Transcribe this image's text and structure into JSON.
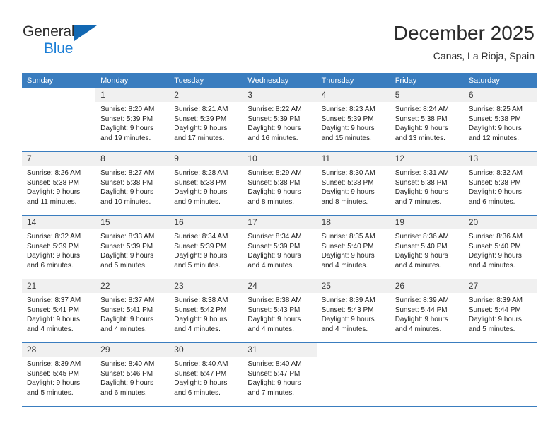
{
  "brand": {
    "name_primary": "General",
    "name_secondary": "Blue",
    "logo_icon": "triangle-logo-icon"
  },
  "header": {
    "month_title": "December 2025",
    "location": "Canas, La Rioja, Spain"
  },
  "calendar": {
    "accent_color": "#3a7dbf",
    "weekday_headers": [
      "Sunday",
      "Monday",
      "Tuesday",
      "Wednesday",
      "Thursday",
      "Friday",
      "Saturday"
    ],
    "weeks": [
      [
        {
          "day": "",
          "lines": []
        },
        {
          "day": "1",
          "lines": [
            "Sunrise: 8:20 AM",
            "Sunset: 5:39 PM",
            "Daylight: 9 hours",
            "and 19 minutes."
          ]
        },
        {
          "day": "2",
          "lines": [
            "Sunrise: 8:21 AM",
            "Sunset: 5:39 PM",
            "Daylight: 9 hours",
            "and 17 minutes."
          ]
        },
        {
          "day": "3",
          "lines": [
            "Sunrise: 8:22 AM",
            "Sunset: 5:39 PM",
            "Daylight: 9 hours",
            "and 16 minutes."
          ]
        },
        {
          "day": "4",
          "lines": [
            "Sunrise: 8:23 AM",
            "Sunset: 5:39 PM",
            "Daylight: 9 hours",
            "and 15 minutes."
          ]
        },
        {
          "day": "5",
          "lines": [
            "Sunrise: 8:24 AM",
            "Sunset: 5:38 PM",
            "Daylight: 9 hours",
            "and 13 minutes."
          ]
        },
        {
          "day": "6",
          "lines": [
            "Sunrise: 8:25 AM",
            "Sunset: 5:38 PM",
            "Daylight: 9 hours",
            "and 12 minutes."
          ]
        }
      ],
      [
        {
          "day": "7",
          "lines": [
            "Sunrise: 8:26 AM",
            "Sunset: 5:38 PM",
            "Daylight: 9 hours",
            "and 11 minutes."
          ]
        },
        {
          "day": "8",
          "lines": [
            "Sunrise: 8:27 AM",
            "Sunset: 5:38 PM",
            "Daylight: 9 hours",
            "and 10 minutes."
          ]
        },
        {
          "day": "9",
          "lines": [
            "Sunrise: 8:28 AM",
            "Sunset: 5:38 PM",
            "Daylight: 9 hours",
            "and 9 minutes."
          ]
        },
        {
          "day": "10",
          "lines": [
            "Sunrise: 8:29 AM",
            "Sunset: 5:38 PM",
            "Daylight: 9 hours",
            "and 8 minutes."
          ]
        },
        {
          "day": "11",
          "lines": [
            "Sunrise: 8:30 AM",
            "Sunset: 5:38 PM",
            "Daylight: 9 hours",
            "and 8 minutes."
          ]
        },
        {
          "day": "12",
          "lines": [
            "Sunrise: 8:31 AM",
            "Sunset: 5:38 PM",
            "Daylight: 9 hours",
            "and 7 minutes."
          ]
        },
        {
          "day": "13",
          "lines": [
            "Sunrise: 8:32 AM",
            "Sunset: 5:38 PM",
            "Daylight: 9 hours",
            "and 6 minutes."
          ]
        }
      ],
      [
        {
          "day": "14",
          "lines": [
            "Sunrise: 8:32 AM",
            "Sunset: 5:39 PM",
            "Daylight: 9 hours",
            "and 6 minutes."
          ]
        },
        {
          "day": "15",
          "lines": [
            "Sunrise: 8:33 AM",
            "Sunset: 5:39 PM",
            "Daylight: 9 hours",
            "and 5 minutes."
          ]
        },
        {
          "day": "16",
          "lines": [
            "Sunrise: 8:34 AM",
            "Sunset: 5:39 PM",
            "Daylight: 9 hours",
            "and 5 minutes."
          ]
        },
        {
          "day": "17",
          "lines": [
            "Sunrise: 8:34 AM",
            "Sunset: 5:39 PM",
            "Daylight: 9 hours",
            "and 4 minutes."
          ]
        },
        {
          "day": "18",
          "lines": [
            "Sunrise: 8:35 AM",
            "Sunset: 5:40 PM",
            "Daylight: 9 hours",
            "and 4 minutes."
          ]
        },
        {
          "day": "19",
          "lines": [
            "Sunrise: 8:36 AM",
            "Sunset: 5:40 PM",
            "Daylight: 9 hours",
            "and 4 minutes."
          ]
        },
        {
          "day": "20",
          "lines": [
            "Sunrise: 8:36 AM",
            "Sunset: 5:40 PM",
            "Daylight: 9 hours",
            "and 4 minutes."
          ]
        }
      ],
      [
        {
          "day": "21",
          "lines": [
            "Sunrise: 8:37 AM",
            "Sunset: 5:41 PM",
            "Daylight: 9 hours",
            "and 4 minutes."
          ]
        },
        {
          "day": "22",
          "lines": [
            "Sunrise: 8:37 AM",
            "Sunset: 5:41 PM",
            "Daylight: 9 hours",
            "and 4 minutes."
          ]
        },
        {
          "day": "23",
          "lines": [
            "Sunrise: 8:38 AM",
            "Sunset: 5:42 PM",
            "Daylight: 9 hours",
            "and 4 minutes."
          ]
        },
        {
          "day": "24",
          "lines": [
            "Sunrise: 8:38 AM",
            "Sunset: 5:43 PM",
            "Daylight: 9 hours",
            "and 4 minutes."
          ]
        },
        {
          "day": "25",
          "lines": [
            "Sunrise: 8:39 AM",
            "Sunset: 5:43 PM",
            "Daylight: 9 hours",
            "and 4 minutes."
          ]
        },
        {
          "day": "26",
          "lines": [
            "Sunrise: 8:39 AM",
            "Sunset: 5:44 PM",
            "Daylight: 9 hours",
            "and 4 minutes."
          ]
        },
        {
          "day": "27",
          "lines": [
            "Sunrise: 8:39 AM",
            "Sunset: 5:44 PM",
            "Daylight: 9 hours",
            "and 5 minutes."
          ]
        }
      ],
      [
        {
          "day": "28",
          "lines": [
            "Sunrise: 8:39 AM",
            "Sunset: 5:45 PM",
            "Daylight: 9 hours",
            "and 5 minutes."
          ]
        },
        {
          "day": "29",
          "lines": [
            "Sunrise: 8:40 AM",
            "Sunset: 5:46 PM",
            "Daylight: 9 hours",
            "and 6 minutes."
          ]
        },
        {
          "day": "30",
          "lines": [
            "Sunrise: 8:40 AM",
            "Sunset: 5:47 PM",
            "Daylight: 9 hours",
            "and 6 minutes."
          ]
        },
        {
          "day": "31",
          "lines": [
            "Sunrise: 8:40 AM",
            "Sunset: 5:47 PM",
            "Daylight: 9 hours",
            "and 7 minutes."
          ]
        },
        {
          "day": "",
          "lines": []
        },
        {
          "day": "",
          "lines": []
        },
        {
          "day": "",
          "lines": []
        }
      ]
    ]
  }
}
